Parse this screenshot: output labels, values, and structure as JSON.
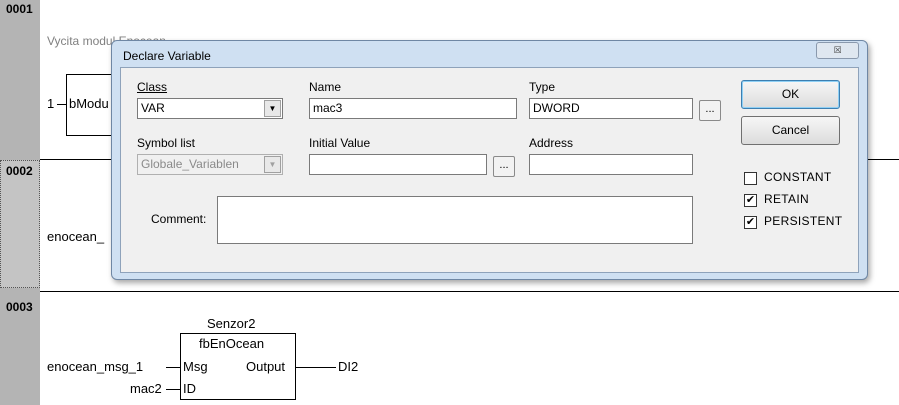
{
  "editor": {
    "rungs": [
      "0001",
      "0002",
      "0003"
    ],
    "rung1_comment": "Vycita modul Enocean",
    "rung1_input": "1",
    "rung1_block": "bModu",
    "rung2_input": "enocean_",
    "rung3": {
      "instance": "Senzor2",
      "type": "fbEnOcean",
      "pin_msg": "Msg",
      "pin_id": "ID",
      "pin_output": "Output",
      "in_msg": "enocean_msg_1",
      "in_id": "mac2",
      "out": "DI2"
    }
  },
  "dialog": {
    "title": "Declare Variable",
    "close_glyph": "☒",
    "class_label": "Class",
    "class_value": "VAR",
    "name_label": "Name",
    "name_value": "mac3",
    "type_label": "Type",
    "type_value": "DWORD",
    "symbol_list_label": "Symbol list",
    "symbol_list_value": "Globale_Variablen",
    "initial_value_label": "Initial Value",
    "initial_value": "",
    "address_label": "Address",
    "address_value": "",
    "comment_label": "Comment:",
    "comment_value": "",
    "ellipsis": "...",
    "ok_label": "OK",
    "cancel_label": "Cancel",
    "checkboxes": [
      {
        "label": "CONSTANT",
        "checked": false
      },
      {
        "label": "RETAIN",
        "checked": true
      },
      {
        "label": "PERSISTENT",
        "checked": true
      }
    ],
    "check_mark": "✔",
    "dropdown_glyph": "▼"
  }
}
